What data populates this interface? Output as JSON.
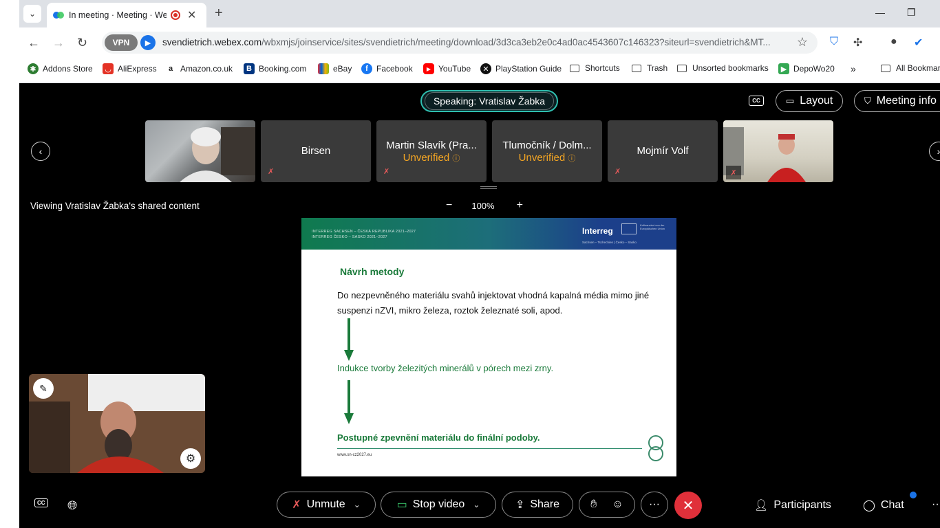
{
  "browser": {
    "tab_title": "In meeting · Meeting · Webex",
    "url_host": "svendietrich.webex.com",
    "url_path": "/wbxmjs/joinservice/sites/svendietrich/meeting/download/3d3ca3eb2e0c4ad0ac4543607c146323?siteurl=svendietrich&MT...",
    "vpn_label": "VPN",
    "new_tab": "+",
    "bookmarks": [
      {
        "label": "Addons Store",
        "color": "#2e7d32"
      },
      {
        "label": "AliExpress",
        "color": "#e43225"
      },
      {
        "label": "Amazon.co.uk",
        "color": "#222222"
      },
      {
        "label": "Booking.com",
        "color": "#003580"
      },
      {
        "label": "eBay",
        "color": "#e53238"
      },
      {
        "label": "Facebook",
        "color": "#1877f2"
      },
      {
        "label": "YouTube",
        "color": "#ff0000"
      },
      {
        "label": "PlayStation Guide",
        "color": "#111111"
      },
      {
        "label": "Shortcuts",
        "color": "#444444"
      },
      {
        "label": "Trash",
        "color": "#444444"
      },
      {
        "label": "Unsorted bookmarks",
        "color": "#444444"
      },
      {
        "label": "DepoWo20",
        "color": "#34a853"
      },
      {
        "label": "All Bookmarks",
        "color": "#444444"
      }
    ],
    "more_bookmarks": "»"
  },
  "meeting": {
    "speaking": "Speaking: Vratislav Žabka",
    "layout_label": "Layout",
    "meeting_info_label": "Meeting info",
    "cc_label": "CC",
    "participants_strip": [
      {
        "name": "",
        "unverified": ""
      },
      {
        "name": "Birsen",
        "unverified": ""
      },
      {
        "name": "Martin Slavík (Pra...",
        "unverified": "Unverified"
      },
      {
        "name": "Tlumočník / Dolm...",
        "unverified": "Unverified"
      },
      {
        "name": "Mojmír Volf",
        "unverified": ""
      },
      {
        "name": "",
        "unverified": ""
      }
    ],
    "viewing": "Viewing Vratislav Žabka's shared content",
    "zoom_minus": "−",
    "zoom_value": "100%",
    "zoom_plus": "+"
  },
  "slide": {
    "header_line1": "INTERREG SACHSEN – ČESKÁ REPUBLIKA 2021–2027",
    "header_line2": "INTERREG ČESKO – SASKO 2021–2027",
    "brand": "Interreg",
    "brand_sub": "Sachsen – Tschechien | Česko – Sasko",
    "eu_text": "Kofinanziert von der Europäischen Union",
    "title": "Návrh metody",
    "body": "Do nezpevněného materiálu svahů injektovat vhodná kapalná média mimo jiné suspenzi nZVI, mikro železa, roztok železnaté soli, apod.",
    "step2": "Indukce tvorby železitých minerálů v pórech mezi zrny.",
    "step3": "Postupné zpevnění materiálu do finální podoby.",
    "footer_url": "www.sn-cz2027.eu",
    "arrow_color": "#1a7a3a"
  },
  "controls": {
    "unmute": "Unmute",
    "stop_video": "Stop video",
    "share": "Share",
    "more": "···",
    "participants": "Participants",
    "chat": "Chat",
    "end_color": "#e0303a"
  }
}
